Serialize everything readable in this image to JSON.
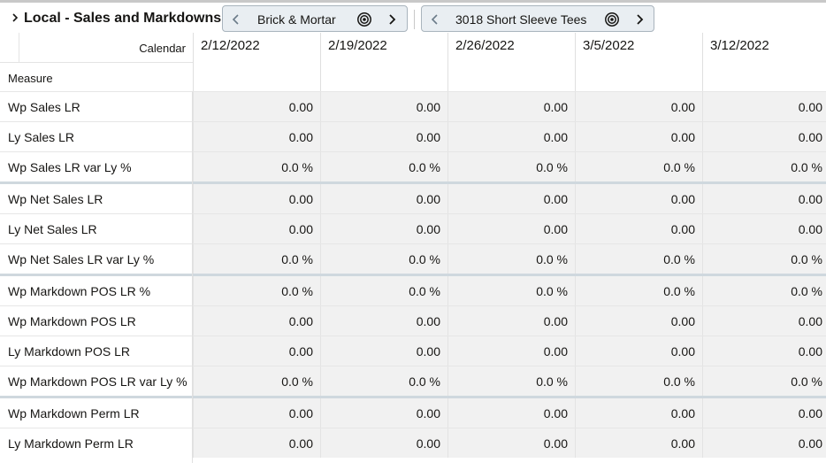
{
  "header": {
    "title": "Local - Sales and Markdowns",
    "tiles": [
      {
        "label": "Brick & Mortar"
      },
      {
        "label": "3018 Short Sleeve Tees"
      }
    ]
  },
  "grid": {
    "calendar_label": "Calendar",
    "measure_label": "Measure",
    "columns": [
      "2/12/2022",
      "2/19/2022",
      "2/26/2022",
      "3/5/2022",
      "3/12/2022"
    ],
    "rows": [
      {
        "label": "Wp Sales LR",
        "values": [
          "0.00",
          "0.00",
          "0.00",
          "0.00",
          "0.00"
        ]
      },
      {
        "label": "Ly Sales LR",
        "values": [
          "0.00",
          "0.00",
          "0.00",
          "0.00",
          "0.00"
        ]
      },
      {
        "label": "Wp Sales LR var Ly %",
        "values": [
          "0.0 %",
          "0.0 %",
          "0.0 %",
          "0.0 %",
          "0.0 %"
        ]
      },
      {
        "label": "Wp Net Sales LR",
        "values": [
          "0.00",
          "0.00",
          "0.00",
          "0.00",
          "0.00"
        ]
      },
      {
        "label": "Ly Net Sales LR",
        "values": [
          "0.00",
          "0.00",
          "0.00",
          "0.00",
          "0.00"
        ]
      },
      {
        "label": "Wp Net Sales LR var Ly %",
        "values": [
          "0.0 %",
          "0.0 %",
          "0.0 %",
          "0.0 %",
          "0.0 %"
        ]
      },
      {
        "label": "Wp Markdown POS LR %",
        "values": [
          "0.0 %",
          "0.0 %",
          "0.0 %",
          "0.0 %",
          "0.0 %"
        ]
      },
      {
        "label": "Wp Markdown POS LR",
        "values": [
          "0.00",
          "0.00",
          "0.00",
          "0.00",
          "0.00"
        ]
      },
      {
        "label": "Ly Markdown POS LR",
        "values": [
          "0.00",
          "0.00",
          "0.00",
          "0.00",
          "0.00"
        ]
      },
      {
        "label": "Wp Markdown POS LR var Ly %",
        "values": [
          "0.0 %",
          "0.0 %",
          "0.0 %",
          "0.0 %",
          "0.0 %"
        ]
      },
      {
        "label": "Wp Markdown Perm LR",
        "values": [
          "0.00",
          "0.00",
          "0.00",
          "0.00",
          "0.00"
        ]
      },
      {
        "label": "Ly Markdown Perm LR",
        "values": [
          "0.00",
          "0.00",
          "0.00",
          "0.00",
          "0.00"
        ]
      }
    ]
  }
}
